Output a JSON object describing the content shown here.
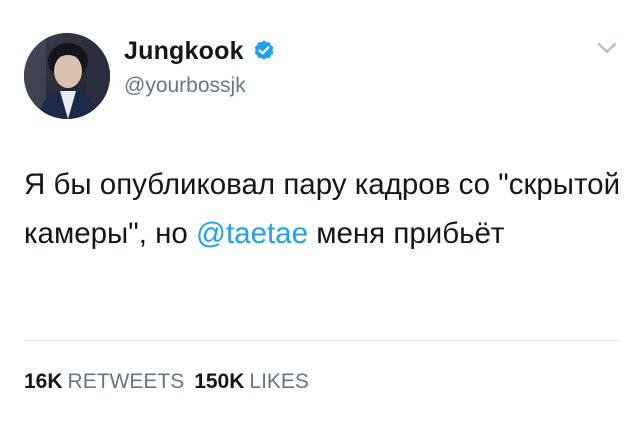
{
  "user": {
    "display_name": "Jungkook",
    "handle": "@yourbossjk",
    "verified": true,
    "verified_icon": "verified-badge-icon",
    "avatar": "profile-photo"
  },
  "menu": {
    "icon": "chevron-down-icon"
  },
  "tweet": {
    "text_part1": "Я бы опубликовал пару кадров со \"скрытой камеры\", но ",
    "mention": "@taetae",
    "text_part2": " меня прибьёт"
  },
  "stats": {
    "retweets_count": "16K",
    "retweets_label": "RETWEETS",
    "likes_count": "150K",
    "likes_label": "LIKES"
  },
  "colors": {
    "accent": "#1da1f2",
    "text": "#14171a",
    "secondary": "#657786",
    "divider": "#e1e8ed"
  }
}
